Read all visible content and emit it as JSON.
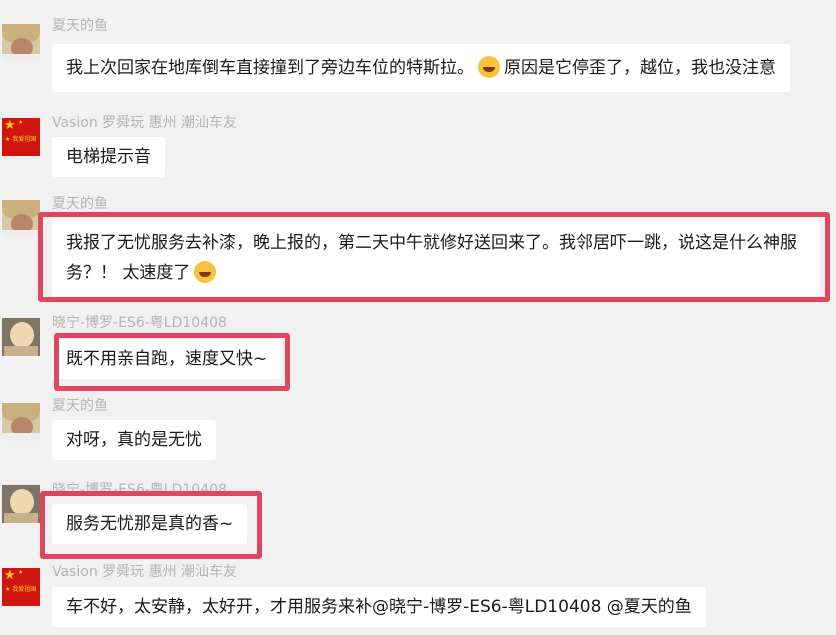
{
  "messages": [
    {
      "name": "夏天的鱼",
      "text": "我上次回家在地库倒车直接撞到了旁边车位的特斯拉。",
      "text2": "原因是它停歪了，越位，我也没注意",
      "emoji": "crying-laughing-emoji"
    },
    {
      "name": "Vasion 罗舜玩 惠州 潮汕车友",
      "text": "电梯提示音"
    },
    {
      "name": "夏天的鱼",
      "text": "我报了无忧服务去补漆，晚上报的，第二天中午就修好送回来了。我邻居吓一跳，说这是什么神服务？！ 太速度了",
      "emoji": "tears-of-joy-emoji"
    },
    {
      "name": "晓宁-博罗-ES6-粤LD10408",
      "text": "既不用亲自跑，速度又快~"
    },
    {
      "name": "夏天的鱼",
      "text": "对呀，真的是无忧"
    },
    {
      "name": "晓宁-博罗-ES6-粤LD10408",
      "text": "服务无忧那是真的香~"
    },
    {
      "name": "Vasion 罗舜玩 惠州 潮汕车友",
      "text": "车不好，太安静，太好开，才用服务来补@晓宁-博罗-ES6-粤LD10408 @夏天的鱼"
    }
  ],
  "avatar_flag_text": "★ 我爱祖国"
}
